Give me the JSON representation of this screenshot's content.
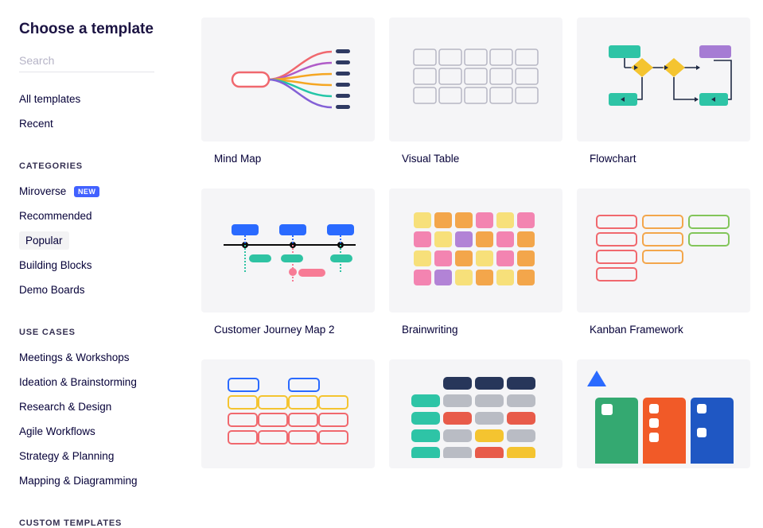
{
  "title": "Choose a template",
  "search": {
    "placeholder": "Search"
  },
  "nav": {
    "top": [
      "All templates",
      "Recent"
    ]
  },
  "sections": [
    {
      "label": "CATEGORIES",
      "items": [
        {
          "label": "Miroverse",
          "new": true
        },
        {
          "label": "Recommended"
        },
        {
          "label": "Popular",
          "selected": true
        },
        {
          "label": "Building Blocks"
        },
        {
          "label": "Demo Boards"
        }
      ]
    },
    {
      "label": "USE CASES",
      "items": [
        {
          "label": "Meetings & Workshops"
        },
        {
          "label": "Ideation & Brainstorming"
        },
        {
          "label": "Research & Design"
        },
        {
          "label": "Agile Workflows"
        },
        {
          "label": "Strategy & Planning"
        },
        {
          "label": "Mapping & Diagramming"
        }
      ]
    },
    {
      "label": "CUSTOM TEMPLATES",
      "items": []
    }
  ],
  "badge_new": "NEW",
  "templates": [
    {
      "title": "Mind Map"
    },
    {
      "title": "Visual Table"
    },
    {
      "title": "Flowchart"
    },
    {
      "title": "Customer Journey Map 2"
    },
    {
      "title": "Brainwriting"
    },
    {
      "title": "Kanban Framework"
    },
    {
      "title": ""
    },
    {
      "title": ""
    },
    {
      "title": ""
    }
  ]
}
